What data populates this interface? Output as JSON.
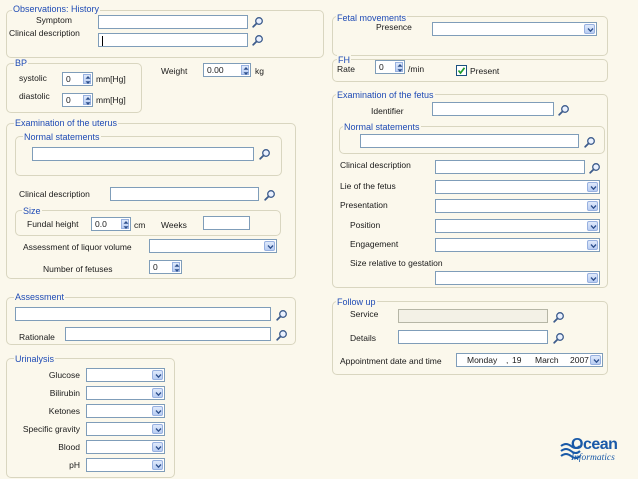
{
  "observations": {
    "title": "Observations: History",
    "symptom_label": "Symptom",
    "clinical_label": "Clinical description"
  },
  "bp": {
    "title": "BP",
    "systolic_label": "systolic",
    "systolic_value": "0",
    "diastolic_label": "diastolic",
    "diastolic_value": "0",
    "unit": "mm[Hg]"
  },
  "weight": {
    "label": "Weight",
    "value": "0.00",
    "unit": "kg"
  },
  "uterus": {
    "title": "Examination of the uterus",
    "normal_title": "Normal statements",
    "clinical_label": "Clinical description",
    "size_title": "Size",
    "fundal_label": "Fundal height",
    "fundal_value": "0.0",
    "fundal_unit": "cm",
    "weeks_label": "Weeks",
    "liquor_label": "Assessment of liquor volume",
    "fetuses_label": "Number of fetuses",
    "fetuses_value": "0"
  },
  "assessment": {
    "title": "Assessment",
    "rationale_label": "Rationale"
  },
  "urinalysis": {
    "title": "Urinalysis",
    "items": [
      "Glucose",
      "Bilirubin",
      "Ketones",
      "Specific gravity",
      "Blood",
      "pH"
    ]
  },
  "fetal_movements": {
    "title": "Fetal movements",
    "presence_label": "Presence"
  },
  "fh": {
    "title": "FH",
    "rate_label": "Rate",
    "rate_value": "0",
    "rate_unit": "/min",
    "present_label": "Present",
    "present_checked": true
  },
  "fetus": {
    "title": "Examination of the fetus",
    "identifier_label": "Identifier",
    "normal_title": "Normal statements",
    "clinical_label": "Clinical description",
    "lie_label": "Lie of the fetus",
    "presentation_label": "Presentation",
    "position_label": "Position",
    "engagement_label": "Engagement",
    "size_relative_label": "Size relative to gestation"
  },
  "followup": {
    "title": "Follow up",
    "service_label": "Service",
    "details_label": "Details",
    "appointment_label": "Appointment date and time",
    "appointment_day": "Monday",
    "appointment_date": "19",
    "appointment_month": "March",
    "appointment_year": "2007"
  },
  "logo": {
    "line1": "Ocean",
    "line2": "Informatics"
  },
  "colors": {
    "title_blue": "#1f4bb5",
    "logo_blue": "#1a5aa8"
  }
}
